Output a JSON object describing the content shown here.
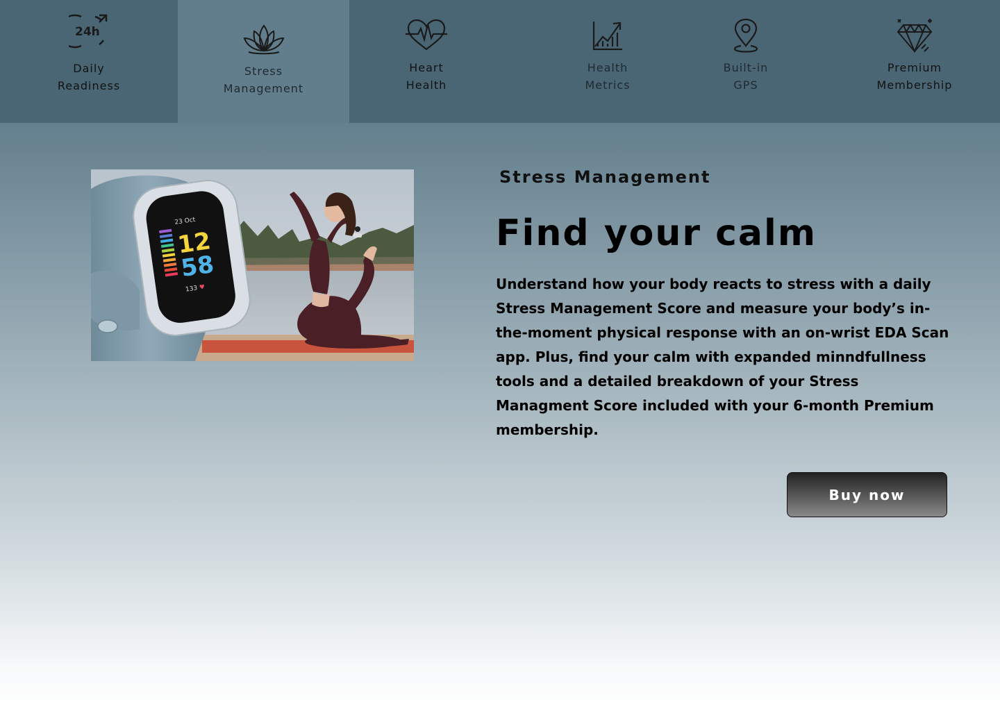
{
  "tabs": [
    {
      "id": "daily-readiness",
      "label": "Daily\nReadiness",
      "icon": "24h-clock-icon",
      "icon_text": "24h",
      "active": false
    },
    {
      "id": "stress-management",
      "label": "Stress\nManagement",
      "icon": "lotus-icon",
      "active": true
    },
    {
      "id": "heart-health",
      "label": "Heart\nHealth",
      "icon": "heartbeat-icon",
      "active": false
    },
    {
      "id": "health-metrics",
      "label": "Health\nMetrics",
      "icon": "trending-chart-icon",
      "active": false
    },
    {
      "id": "built-in-gps",
      "label": "Built-in\nGPS",
      "icon": "map-pin-icon",
      "active": false
    },
    {
      "id": "premium-membership",
      "label": "Premium\nMembership",
      "icon": "diamond-icon",
      "active": false
    }
  ],
  "feature": {
    "eyebrow": "Stress Management",
    "headline": "Find your calm",
    "body": "Understand how your body reacts to stress with a daily Stress Management Score and measure your body’s in-the-moment physical response with an on-wrist EDA Scan app. Plus, find your calm with expanded minndfullness tools and a detailed breakdown of your Stress Managment Score included with your 6-month Premium membership.",
    "image": {
      "alt": "Fitness tracker next to woman doing yoga pose by a lake",
      "watch_date": "23 Oct",
      "watch_hour": "12",
      "watch_minute": "58",
      "watch_heart_rate": "133"
    },
    "cta_label": "Buy now"
  },
  "colors": {
    "tabbar_bg": "#4a6674",
    "tab_active_bg": "#627d8b",
    "button_dark": "#222222",
    "button_light": "#8a8a8a",
    "heart_red": "#e84a5f"
  }
}
